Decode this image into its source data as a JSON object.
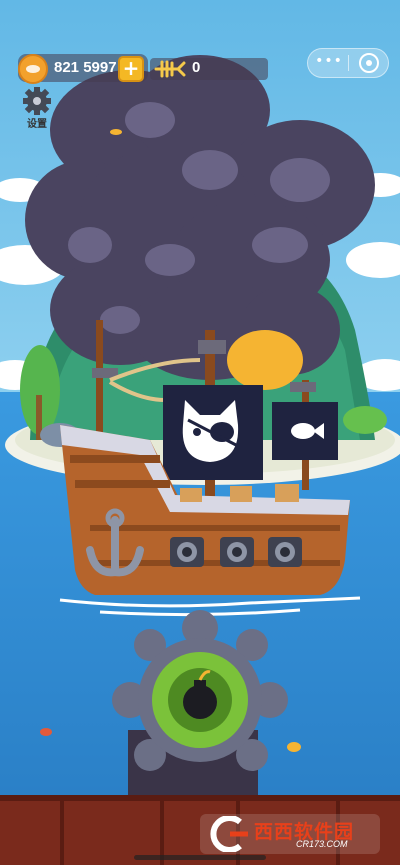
{
  "hud": {
    "coins": "821 5997",
    "fishbones": "0",
    "add_label": "+",
    "settings_label": "设置",
    "more_label": "•••"
  },
  "watermark": {
    "logo_text": "西西软件园",
    "site_text": "CR173.COM"
  },
  "colors": {
    "sky": "#5aa8d8",
    "sea": "#2f8fd6",
    "smoke": "#4a4460",
    "hull": "#b5642c",
    "cannon_green": "#7bc23a",
    "coin": "#f2a12c",
    "deck_red": "#7a2a1c"
  },
  "icons": [
    "coin-icon",
    "plus-icon",
    "fishbone-icon",
    "gear-icon",
    "cat-pirate-flag-icon",
    "fish-flag-icon",
    "anchor-icon",
    "bomb-icon",
    "more-dots-icon",
    "close-target-icon"
  ]
}
